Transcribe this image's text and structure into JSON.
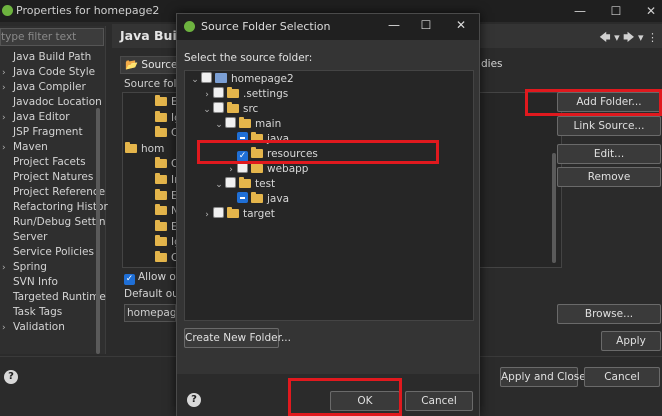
{
  "back_window": {
    "title": "Properties for homepage2",
    "filter_placeholder": "type filter text",
    "nav_items": [
      {
        "label": "Java Build Path",
        "chev": ""
      },
      {
        "label": "Java Code Style",
        "chev": "›"
      },
      {
        "label": "Java Compiler",
        "chev": "›"
      },
      {
        "label": "Javadoc Location",
        "chev": ""
      },
      {
        "label": "Java Editor",
        "chev": "›"
      },
      {
        "label": "JSP Fragment",
        "chev": ""
      },
      {
        "label": "Maven",
        "chev": "›"
      },
      {
        "label": "Project Facets",
        "chev": ""
      },
      {
        "label": "Project Natures",
        "chev": ""
      },
      {
        "label": "Project Reference",
        "chev": ""
      },
      {
        "label": "Refactoring Histor",
        "chev": ""
      },
      {
        "label": "Run/Debug Settin",
        "chev": ""
      },
      {
        "label": "Server",
        "chev": ""
      },
      {
        "label": "Service Policies",
        "chev": ""
      },
      {
        "label": "Spring",
        "chev": "›"
      },
      {
        "label": "SVN Info",
        "chev": ""
      },
      {
        "label": "Targeted Runtime",
        "chev": ""
      },
      {
        "label": "Task Tags",
        "chev": ""
      },
      {
        "label": "Validation",
        "chev": "›"
      }
    ],
    "section_title": "Java Build",
    "tabs": {
      "source": "Source",
      "libraries_partial": "dies"
    },
    "source_folders_label": "Source fold",
    "tree_rows": [
      "Ex",
      "Ig",
      "Cl",
      "hom",
      "O",
      "In",
      "Ex",
      "N",
      "Ex",
      "Ig",
      "Cl"
    ],
    "buttons": {
      "add_folder": "Add Folder...",
      "link_source": "Link Source...",
      "edit": "Edit...",
      "remove": "Remove",
      "browse": "Browse...",
      "apply": "Apply",
      "apply_close": "Apply and Close",
      "cancel": "Cancel"
    },
    "allow_output": "Allow ou",
    "default_output": "Default ou",
    "output_value": "homepage2"
  },
  "dialog": {
    "title": "Source Folder Selection",
    "label": "Select the source folder:",
    "tree": [
      {
        "label": "homepage2",
        "twisty": "⌄",
        "check": "none",
        "icon": "project",
        "indent": 0
      },
      {
        "label": ".settings",
        "twisty": "›",
        "check": "none",
        "icon": "folder",
        "indent": 1
      },
      {
        "label": "src",
        "twisty": "⌄",
        "check": "none",
        "icon": "folder",
        "indent": 1
      },
      {
        "label": "main",
        "twisty": "⌄",
        "check": "none",
        "icon": "folder",
        "indent": 2
      },
      {
        "label": "java",
        "twisty": "",
        "check": "partial",
        "icon": "folder",
        "indent": 3
      },
      {
        "label": "resources",
        "twisty": "",
        "check": "checked",
        "icon": "folder",
        "indent": 3
      },
      {
        "label": "webapp",
        "twisty": "›",
        "check": "none",
        "icon": "folder",
        "indent": 3
      },
      {
        "label": "test",
        "twisty": "⌄",
        "check": "none",
        "icon": "folder",
        "indent": 2
      },
      {
        "label": "java",
        "twisty": "",
        "check": "partial",
        "icon": "folder",
        "indent": 3
      },
      {
        "label": "target",
        "twisty": "›",
        "check": "none",
        "icon": "folder",
        "indent": 1
      }
    ],
    "create_new_folder": "Create New Folder...",
    "ok": "OK",
    "cancel": "Cancel"
  },
  "colors": {
    "highlight": "#e0191e",
    "accent": "#1f6fd6",
    "folder": "#e4b54b"
  }
}
